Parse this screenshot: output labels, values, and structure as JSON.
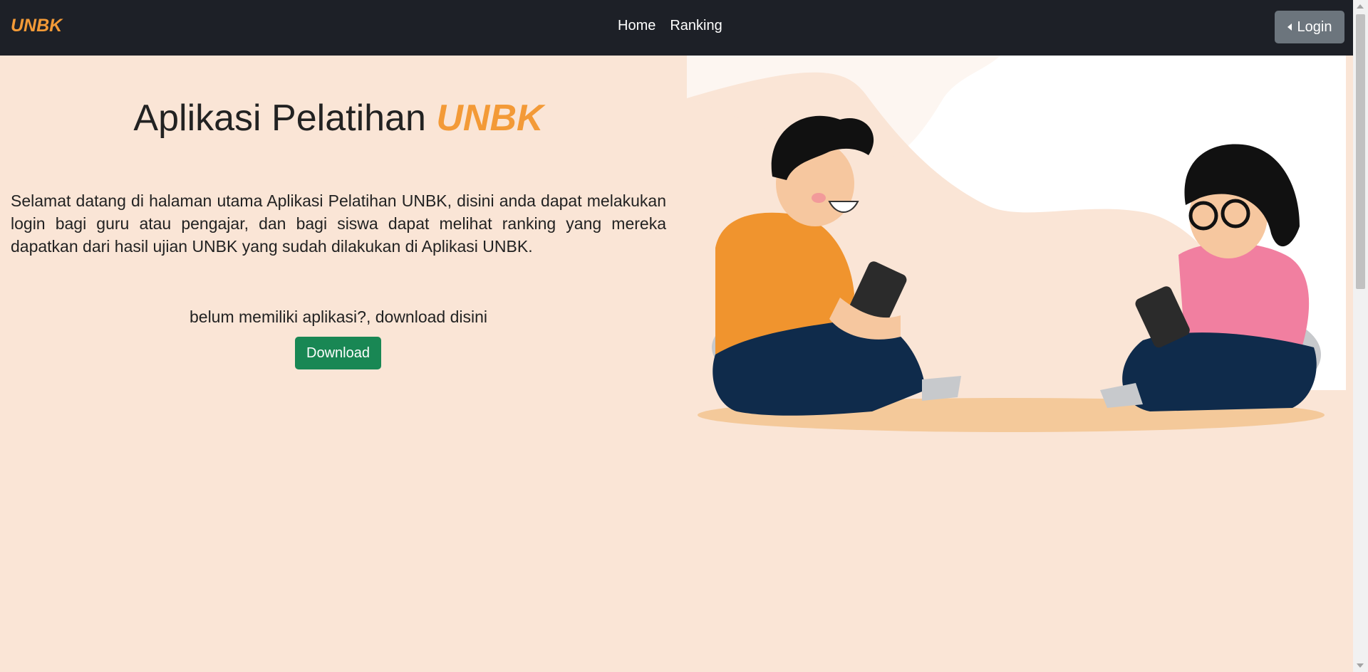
{
  "navbar": {
    "brand": "UNBK",
    "links": [
      {
        "label": "Home"
      },
      {
        "label": "Ranking"
      }
    ],
    "login_label": "Login"
  },
  "hero": {
    "title_prefix": "Aplikasi Pelatihan",
    "title_accent": "UNBK",
    "description": "Selamat datang di halaman utama Aplikasi Pelatihan UNBK, disini anda dapat melakukan login bagi guru atau pengajar, dan bagi siswa dapat melihat ranking yang mereka dapatkan dari hasil ujian UNBK yang sudah dilakukan di Aplikasi UNBK.",
    "download_prompt": "belum memiliki aplikasi?, download disini",
    "download_label": "Download"
  },
  "colors": {
    "accent": "#f39a37",
    "navbar": "#1d2027",
    "background": "#fae5d6",
    "download": "#198754",
    "login": "#6c757d"
  }
}
